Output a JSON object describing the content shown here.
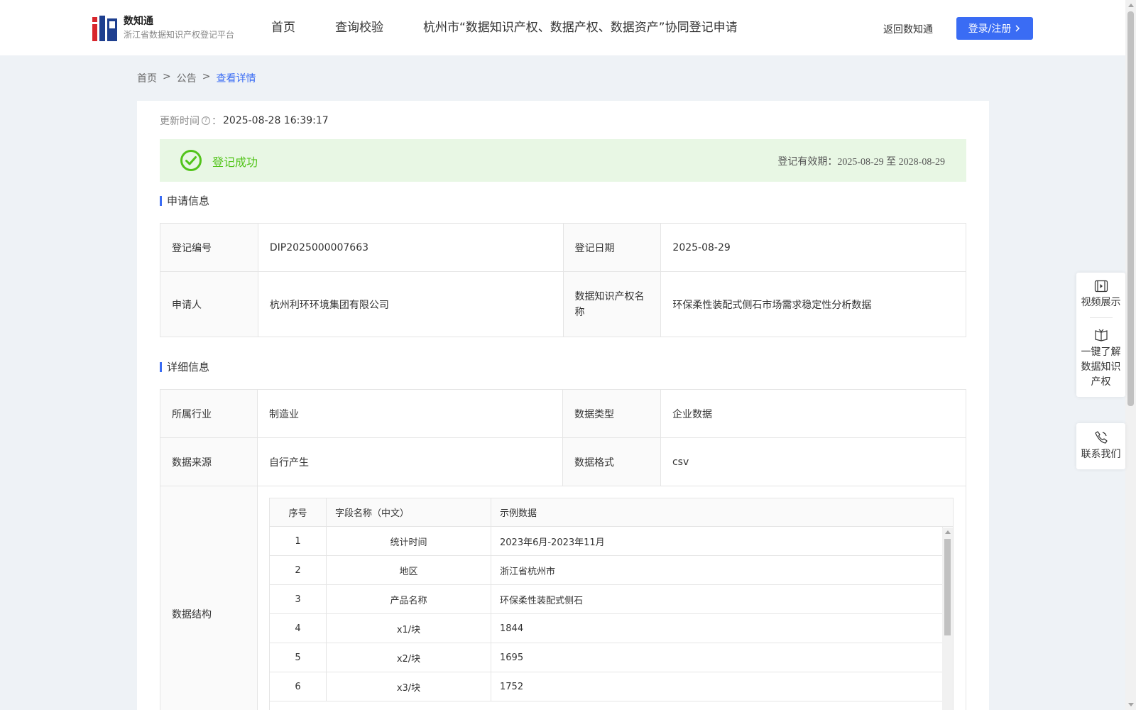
{
  "header": {
    "logo_name": "数知通",
    "logo_sub": "浙江省数据知识产权登记平台",
    "nav": [
      "首页",
      "查询校验",
      "杭州市“数据知识产权、数据产权、数据资产”协同登记申请"
    ],
    "back_link": "返回数知通",
    "login_label": "登录/注册"
  },
  "breadcrumb": {
    "items": [
      "首页",
      "公告",
      "查看详情"
    ],
    "separator": ">"
  },
  "update": {
    "label": "更新时间",
    "colon": "：",
    "value": "2025-08-28 16:39:17"
  },
  "status": {
    "text": "登记成功",
    "valid_label": "登记有效期：",
    "valid_from": "2025-08-29",
    "valid_to_word": "至",
    "valid_to": "2028-08-29",
    "color": "#52c41a"
  },
  "apply_section": {
    "title": "申请信息",
    "rows": [
      {
        "k1": "登记编号",
        "v1": "DIP2025000007663",
        "k2": "登记日期",
        "v2": "2025-08-29"
      },
      {
        "k1": "申请人",
        "v1": "杭州利环环境集团有限公司",
        "k2": "数据知识产权名称",
        "v2": "环保柔性装配式侧石市场需求稳定性分析数据"
      }
    ]
  },
  "detail_section": {
    "title": "详细信息",
    "rows": [
      {
        "k1": "所属行业",
        "v1": "制造业",
        "k2": "数据类型",
        "v2": "企业数据"
      },
      {
        "k1": "数据来源",
        "v1": "自行产生",
        "k2": "数据格式",
        "v2": "csv"
      }
    ],
    "structure_label": "数据结构",
    "structure_headers": [
      "序号",
      "字段名称（中文）",
      "示例数据"
    ],
    "structure_rows": [
      [
        "1",
        "统计时间",
        "2023年6月-2023年11月"
      ],
      [
        "2",
        "地区",
        "浙江省杭州市"
      ],
      [
        "3",
        "产品名称",
        "环保柔性装配式侧石"
      ],
      [
        "4",
        "x1/块",
        "1844"
      ],
      [
        "5",
        "x2/块",
        "1695"
      ],
      [
        "6",
        "x3/块",
        "1752"
      ]
    ]
  },
  "side_panel": {
    "video": "视频展示",
    "learn": "一键了解数据知识产权",
    "contact": "联系我们"
  },
  "colors": {
    "accent": "#3a6cf4",
    "success": "#52c41a",
    "success_bg": "#e8f7e4"
  }
}
